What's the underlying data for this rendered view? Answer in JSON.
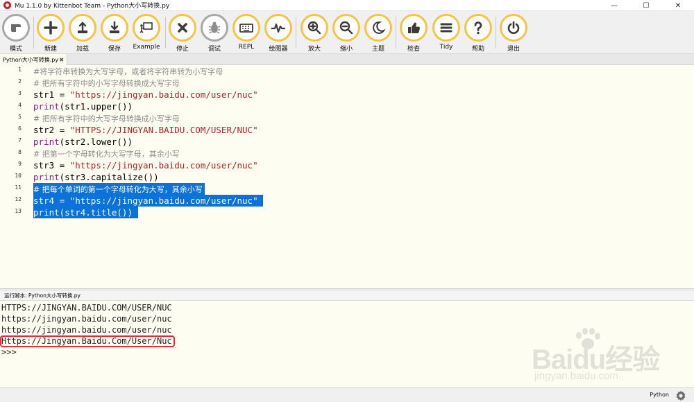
{
  "window": {
    "title": "Mu 1.1.0 by Kittenbot Team - Python大小写转换.py",
    "minimize": "—",
    "maximize": "☐",
    "close": "✕"
  },
  "toolbar": {
    "mode": "模式",
    "new": "新建",
    "load": "加载",
    "save": "保存",
    "example": "Example",
    "stop": "停止",
    "debug": "调试",
    "repl": "REPL",
    "plotter": "绘图器",
    "zoom_in": "放大",
    "zoom_out": "缩小",
    "theme": "主题",
    "check": "检查",
    "tidy": "Tidy",
    "help": "帮助",
    "quit": "退出"
  },
  "tab": {
    "label": "Python大小写转换.py",
    "close": "✖"
  },
  "editor": {
    "line_numbers": [
      "1",
      "2",
      "3",
      "4",
      "5",
      "6",
      "7",
      "8",
      "9",
      "10",
      "11",
      "12",
      "13"
    ],
    "lines": {
      "l1": "#将字符串转换为大写字母，或者将字符串转为小写字母",
      "l2": "# 把所有字符中的小写字母转换成大写字母",
      "l3_var": "str1 = ",
      "l3_str": "\"https://jingyan.baidu.com/user/nuc\"",
      "l4_fn": "print",
      "l4_rest": "(str1.upper())",
      "l5": "# 把所有字符中的大写字母转换成小写字母",
      "l6_var": "str2 = ",
      "l6_str": "\"HTTPS://JINGYAN.BAIDU.COM/USER/NUC\"",
      "l7_fn": "print",
      "l7_rest": "(str2.lower())",
      "l8": "# 把第一个字母转化为大写字母，其余小写",
      "l9_var": "str3 = ",
      "l9_str": "\"https://jingyan.baidu.com/user/nuc\"",
      "l10_fn": "print",
      "l10_rest": "(str3.capitalize())",
      "l11": "# 把每个单词的第一个字母转化为大写，其余小写 ",
      "l12": "str4 = \"https://jingyan.baidu.com/user/nuc\" ",
      "l13": "print(str4.title()) "
    }
  },
  "run_header": "运行脚本: Python大小写转换.py",
  "output": {
    "lines": [
      "HTTPS://JINGYAN.BAIDU.COM/USER/NUC",
      "https://jingyan.baidu.com/user/nuc",
      "https://jingyan.baidu.com/user/nuc",
      "Https://Jingyan.Baidu.Com/User/Nuc",
      ">>>"
    ]
  },
  "watermark": {
    "main": "Baidu经验",
    "sub": "jingyan.baidu.com"
  },
  "status": {
    "mode": "Python"
  },
  "colors": {
    "accent_ring": "#f5c542",
    "selection": "#0a72d8",
    "highlight_box": "#e0303a"
  },
  "icons": [
    "mode-icon",
    "new-icon",
    "load-icon",
    "save-icon",
    "example-icon",
    "stop-icon",
    "debug-icon",
    "repl-icon",
    "plotter-icon",
    "zoom-in-icon",
    "zoom-out-icon",
    "theme-icon",
    "check-icon",
    "tidy-icon",
    "help-icon",
    "quit-icon",
    "gear-icon"
  ]
}
